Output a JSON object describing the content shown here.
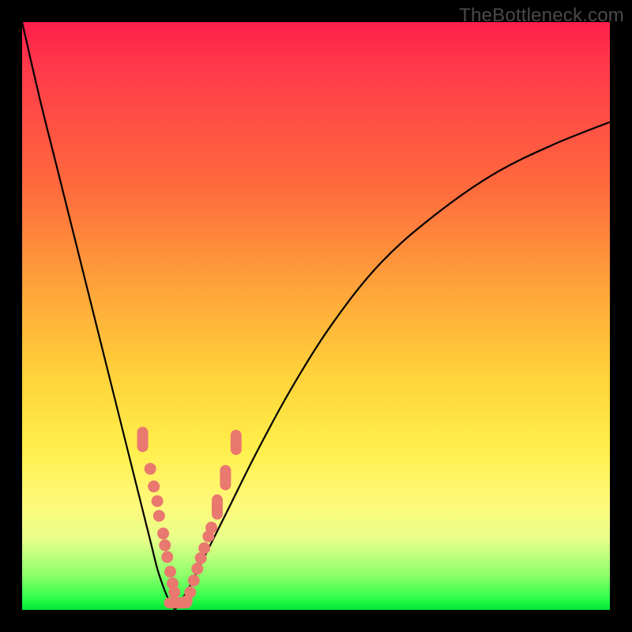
{
  "watermark": "TheBottleneck.com",
  "colors": {
    "frame": "#000000",
    "gradient_top": "#ff1f4b",
    "gradient_mid1": "#ff6a3d",
    "gradient_mid2": "#ffd23a",
    "gradient_mid3": "#fff97a",
    "gradient_bottom": "#00e634",
    "curve": "#000000",
    "marker": "#e9786f"
  },
  "chart_data": {
    "type": "line",
    "title": "",
    "xlabel": "",
    "ylabel": "",
    "xlim": [
      0,
      100
    ],
    "ylim": [
      0,
      100
    ],
    "grid": false,
    "legend": false,
    "series": [
      {
        "name": "left-branch",
        "x": [
          0,
          3,
          6,
          9,
          12,
          15,
          17,
          19,
          20.5,
          22,
          23,
          24,
          24.8,
          25.5,
          26
        ],
        "y": [
          100,
          87,
          75,
          63,
          51,
          39,
          31,
          23,
          17,
          11,
          7,
          4,
          2,
          0.8,
          0
        ]
      },
      {
        "name": "right-branch",
        "x": [
          26,
          27,
          28.5,
          30,
          32,
          35,
          40,
          46,
          53,
          61,
          70,
          80,
          90,
          100
        ],
        "y": [
          0,
          1.5,
          4,
          7,
          11,
          17,
          27,
          38,
          49,
          59,
          67,
          74,
          79,
          83
        ]
      }
    ],
    "markers": [
      {
        "x": 20.5,
        "y": 29,
        "shape": "pill-v"
      },
      {
        "x": 21.8,
        "y": 24,
        "shape": "round"
      },
      {
        "x": 22.4,
        "y": 21,
        "shape": "round"
      },
      {
        "x": 23.0,
        "y": 18.5,
        "shape": "round"
      },
      {
        "x": 23.3,
        "y": 16,
        "shape": "round"
      },
      {
        "x": 24.0,
        "y": 13,
        "shape": "round"
      },
      {
        "x": 24.3,
        "y": 11,
        "shape": "round"
      },
      {
        "x": 24.7,
        "y": 9,
        "shape": "round"
      },
      {
        "x": 25.2,
        "y": 6.5,
        "shape": "round"
      },
      {
        "x": 25.6,
        "y": 4.5,
        "shape": "round"
      },
      {
        "x": 25.9,
        "y": 3,
        "shape": "round"
      },
      {
        "x": 26.0,
        "y": 1.2,
        "shape": "pill-h"
      },
      {
        "x": 27.0,
        "y": 1.2,
        "shape": "pill-h"
      },
      {
        "x": 28.0,
        "y": 1.5,
        "shape": "round"
      },
      {
        "x": 28.6,
        "y": 3,
        "shape": "round"
      },
      {
        "x": 29.2,
        "y": 5,
        "shape": "round"
      },
      {
        "x": 29.8,
        "y": 7,
        "shape": "round"
      },
      {
        "x": 30.4,
        "y": 8.8,
        "shape": "round"
      },
      {
        "x": 31.0,
        "y": 10.5,
        "shape": "round"
      },
      {
        "x": 31.7,
        "y": 12.5,
        "shape": "round"
      },
      {
        "x": 32.2,
        "y": 14,
        "shape": "round"
      },
      {
        "x": 33.2,
        "y": 17.5,
        "shape": "pill-v"
      },
      {
        "x": 34.6,
        "y": 22.5,
        "shape": "pill-v"
      },
      {
        "x": 36.4,
        "y": 28.5,
        "shape": "pill-v"
      }
    ]
  }
}
